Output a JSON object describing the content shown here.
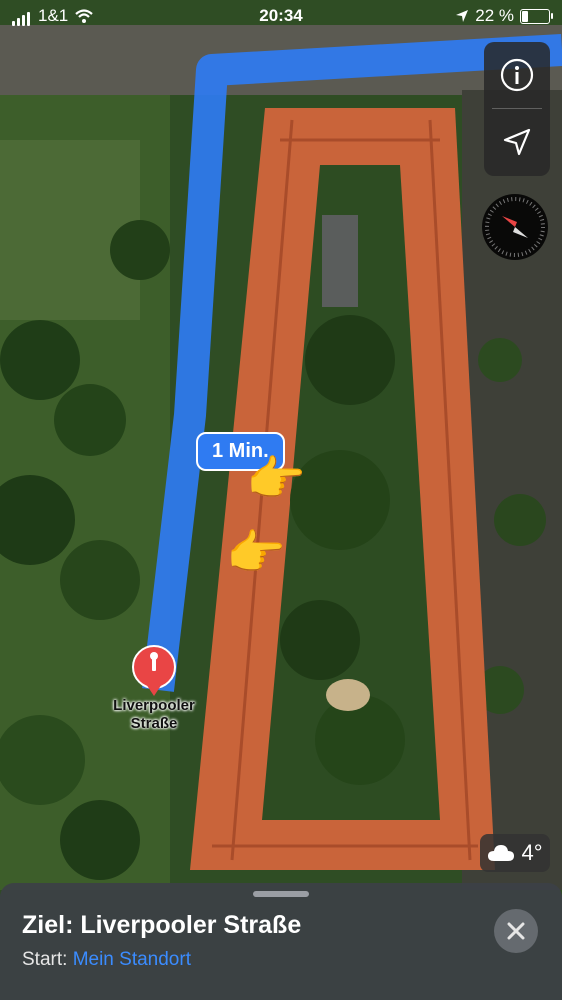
{
  "status_bar": {
    "carrier": "1&1",
    "time": "20:34",
    "battery_percent": "22 %",
    "battery_level": 0.22
  },
  "controls": {
    "info_icon": "info-icon",
    "location_icon": "location-arrow-icon",
    "compass_icon": "compass-icon"
  },
  "route": {
    "eta_label": "1 Min.",
    "color": "#2f7bf2"
  },
  "destination": {
    "pin_label": "Liverpooler Straße",
    "pin_color": "#e94545"
  },
  "weather": {
    "icon": "cloud-icon",
    "temperature": "4°"
  },
  "sheet": {
    "title": "Ziel: Liverpooler Straße",
    "start_label": "Start:",
    "start_value": "Mein Standort",
    "close_icon": "close-icon"
  },
  "annotations": {
    "hand_1": "👉",
    "hand_2": "👉"
  }
}
